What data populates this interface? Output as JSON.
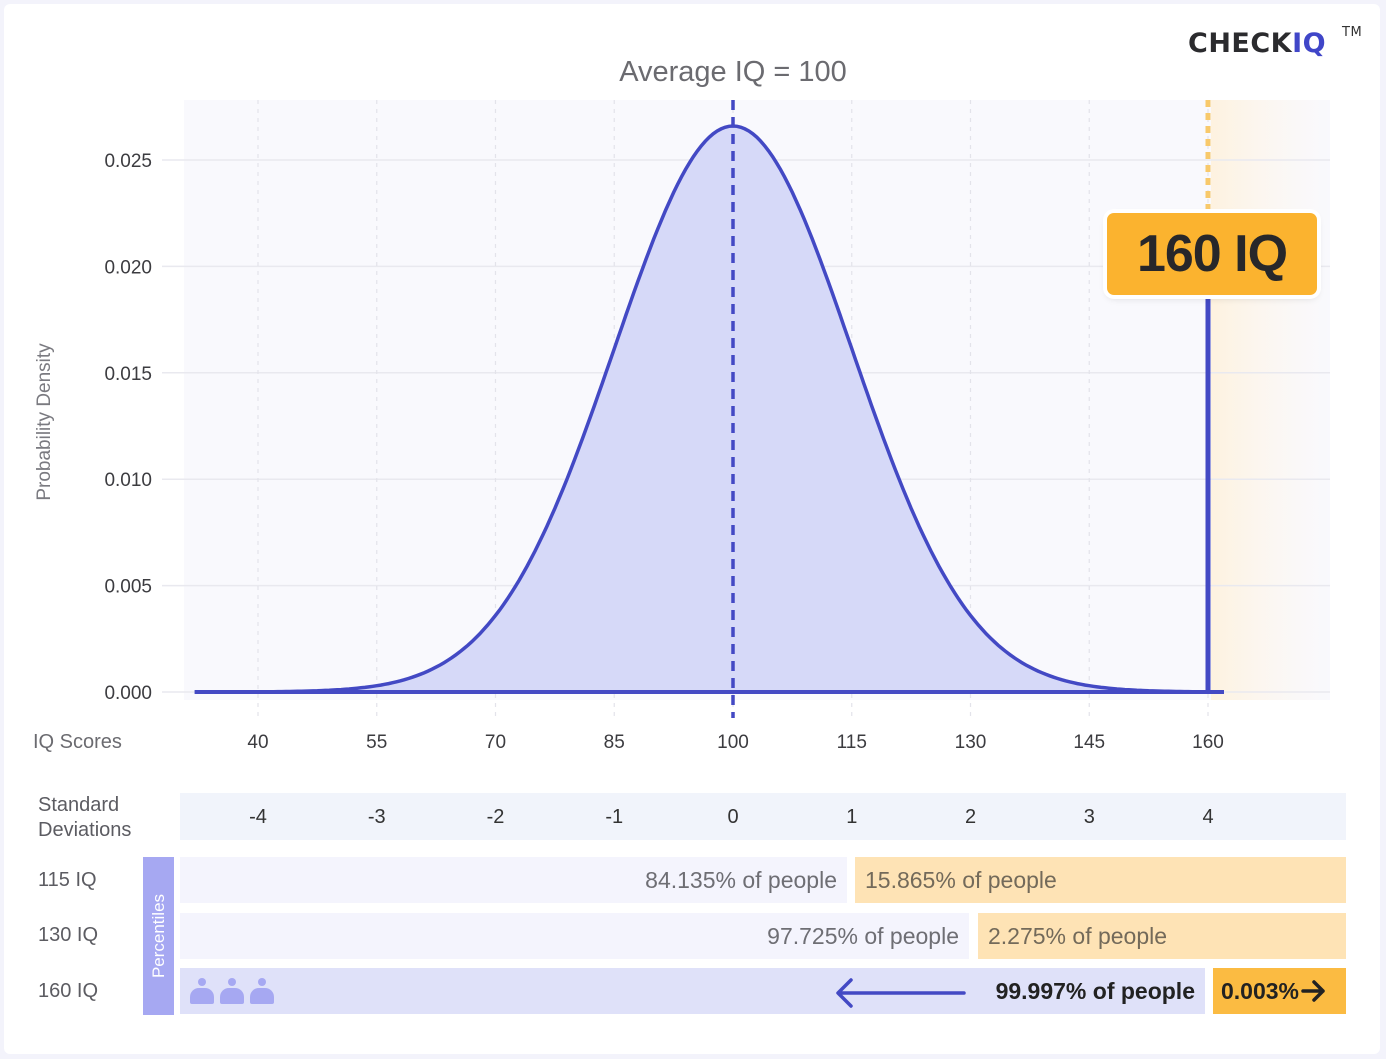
{
  "brand": {
    "name_main": "CHECK",
    "name_accent": "IQ",
    "trademark": "TM",
    "accent_color": "#4046c8"
  },
  "chart_data": {
    "type": "area",
    "title": "Average IQ = 100",
    "xlabel": "IQ Scores",
    "ylabel": "Probability Density",
    "distribution": {
      "kind": "normal",
      "mean": 100,
      "sd": 15
    },
    "x_ticks": [
      40,
      55,
      70,
      85,
      100,
      115,
      130,
      145,
      160
    ],
    "y_ticks": [
      0.0,
      0.005,
      0.01,
      0.015,
      0.02,
      0.025
    ],
    "y_tick_labels": [
      "0.000",
      "0.005",
      "0.010",
      "0.015",
      "0.020",
      "0.025"
    ],
    "xlim": [
      30,
      175
    ],
    "ylim": [
      0,
      0.0277
    ],
    "peak_density": 0.0266,
    "mean_marker": 100,
    "highlight_score": 160,
    "highlight_label": "160 IQ",
    "grid": true,
    "colors": {
      "curve": "#4349c4",
      "fill": "#d6d9f8",
      "highlight": "#fbb32f",
      "plot_bg": "#f9f9fd"
    }
  },
  "sd_row": {
    "label_line1": "Standard",
    "label_line2": "Deviations",
    "ticks": [
      {
        "iq": 40,
        "label": "-4"
      },
      {
        "iq": 55,
        "label": "-3"
      },
      {
        "iq": 70,
        "label": "-2"
      },
      {
        "iq": 85,
        "label": "-1"
      },
      {
        "iq": 100,
        "label": "0"
      },
      {
        "iq": 115,
        "label": "1"
      },
      {
        "iq": 130,
        "label": "2"
      },
      {
        "iq": 145,
        "label": "3"
      },
      {
        "iq": 160,
        "label": "4"
      }
    ]
  },
  "percentiles": {
    "section_label": "Percentiles",
    "rows": [
      {
        "label": "115 IQ",
        "below": "84.135% of people",
        "above": "15.865% of  people",
        "below_pct": 84.135,
        "above_pct": 15.865
      },
      {
        "label": "130 IQ",
        "below": "97.725% of people",
        "above": "2.275% of  people",
        "below_pct": 97.725,
        "above_pct": 2.275
      },
      {
        "label": "160 IQ",
        "below": "99.997% of people",
        "above": "0.003%",
        "below_pct": 99.997,
        "above_pct": 0.003
      }
    ]
  }
}
